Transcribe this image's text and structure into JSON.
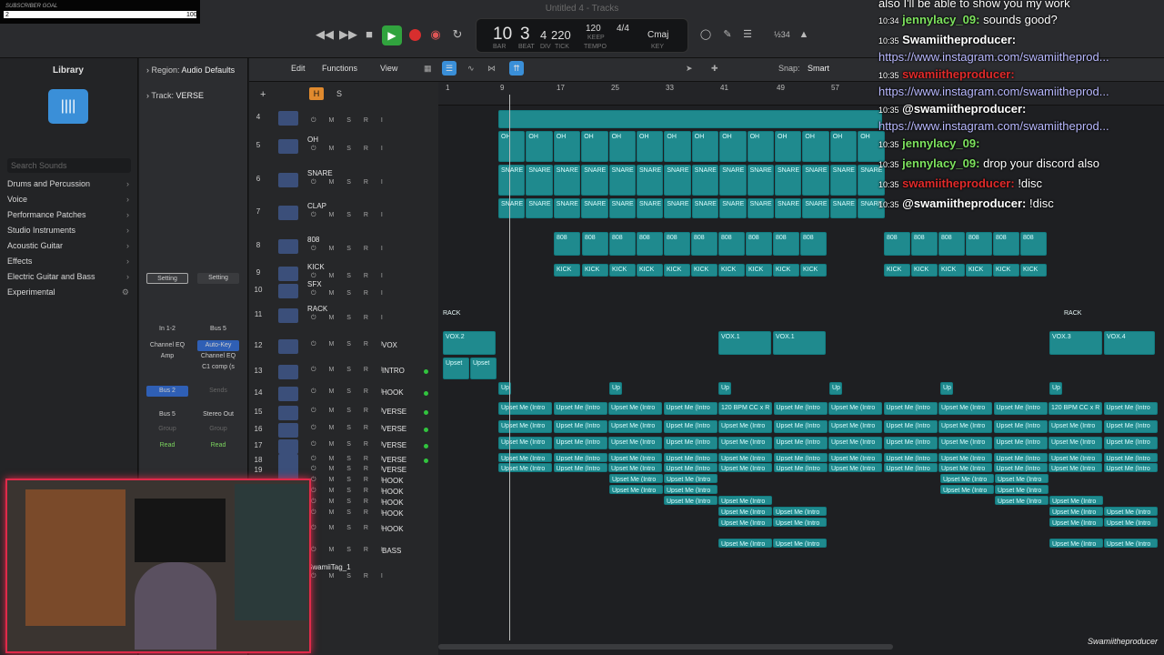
{
  "subscriber": {
    "label": "SUBSCRIBER GOAL",
    "current": "2",
    "goal": "100"
  },
  "window": {
    "title": "Untitled 4 - Tracks"
  },
  "transport": {
    "bar": "10",
    "beat": "3",
    "div": "4",
    "tick": "220",
    "bar_label": "BAR",
    "beat_label": "BEAT",
    "div_label": "DIV",
    "tick_label": "TICK",
    "tempo": "120",
    "tempo_mode": "KEEP",
    "tempo_label": "TEMPO",
    "time_sig": "4/4",
    "key": "Cmaj",
    "key_label": "KEY",
    "cpu": "½34"
  },
  "library": {
    "title": "Library",
    "search_placeholder": "Search Sounds",
    "items": [
      "Drums and Percussion",
      "Voice",
      "Performance Patches",
      "Studio Instruments",
      "Acoustic Guitar",
      "Effects",
      "Electric Guitar and Bass",
      "Experimental"
    ]
  },
  "inspector": {
    "region_label": "Region:",
    "region_value": "Audio Defaults",
    "track_label": "Track:",
    "track_value": "VERSE",
    "setting1": "Setting",
    "setting2": "Setting",
    "input1": "In 1-2",
    "input2": "Bus 5",
    "eq1": "Channel EQ",
    "amp": "Amp",
    "autokey": "Auto-Key",
    "eq2": "Channel EQ",
    "comp": "C1 comp (s",
    "bus2": "Bus 2",
    "sends": "Sends",
    "bus5": "Bus 5",
    "stereo": "Stereo Out",
    "group1": "Group",
    "group2": "Group",
    "read1": "Read",
    "read2": "Read"
  },
  "toolbar": {
    "edit": "Edit",
    "functions": "Functions",
    "view": "View",
    "snap_label": "Snap:",
    "snap_value": "Smart",
    "H": "H",
    "S": "S"
  },
  "tracks": [
    {
      "num": "4",
      "name": ""
    },
    {
      "num": "5",
      "name": "OH"
    },
    {
      "num": "6",
      "name": "SNARE"
    },
    {
      "num": "7",
      "name": "CLAP"
    },
    {
      "num": "8",
      "name": "808"
    },
    {
      "num": "9",
      "name": "KICK"
    },
    {
      "num": "10",
      "name": "SFX"
    },
    {
      "num": "11",
      "name": "RACK"
    },
    {
      "num": "12",
      "name": "VOX"
    },
    {
      "num": "13",
      "name": "INTRO"
    },
    {
      "num": "14",
      "name": "HOOK"
    },
    {
      "num": "15",
      "name": "VERSE"
    },
    {
      "num": "16",
      "name": "VERSE"
    },
    {
      "num": "17",
      "name": "VERSE"
    },
    {
      "num": "18",
      "name": "VERSE"
    },
    {
      "num": "19",
      "name": "VERSE"
    },
    {
      "num": "",
      "name": "HOOK"
    },
    {
      "num": "",
      "name": "HOOK"
    },
    {
      "num": "",
      "name": "HOOK"
    },
    {
      "num": "",
      "name": "HOOK"
    },
    {
      "num": "",
      "name": "HOOK"
    },
    {
      "num": "",
      "name": "BASS"
    },
    {
      "num": "",
      "name": "SwamiiTag_1"
    }
  ],
  "ruler": [
    "1",
    "9",
    "17",
    "25",
    "33",
    "41",
    "49",
    "57"
  ],
  "regions": {
    "oh": "OH",
    "snare": "SNARE",
    "clap": "SNARE",
    "r808": "808",
    "kick": "KICK",
    "rack": "RACK",
    "vox2": "VOX.2",
    "vox1": "VOX.1",
    "vox3": "VOX.3",
    "vox4": "VOX.4",
    "upset": "Upset",
    "up": "Up",
    "upsetme": "Upset Me (Intro",
    "bpm": "120 BPM CC x R"
  },
  "chat": [
    {
      "time": "",
      "user": "",
      "text": "also I'll be able to show you my work"
    },
    {
      "time": "10:34",
      "user": "jennylacy_09:",
      "text": "sounds good?"
    },
    {
      "time": "10:35",
      "user": "Swamiitheproducer:",
      "text": ""
    },
    {
      "time": "",
      "user": "",
      "text": "https://www.instagram.com/swamiitheprod..."
    },
    {
      "time": "10:35",
      "user": "swamiitheproducer:",
      "text": ""
    },
    {
      "time": "",
      "user": "",
      "text": "https://www.instagram.com/swamiitheprod..."
    },
    {
      "time": "10:35",
      "user": "@swamiitheproducer:",
      "text": ""
    },
    {
      "time": "",
      "user": "",
      "text": "https://www.instagram.com/swamiitheprod..."
    },
    {
      "time": "10:35",
      "user": "jennylacy_09:",
      "text": ""
    },
    {
      "time": "10:35",
      "user": "jennylacy_09:",
      "text": "drop your discord also"
    },
    {
      "time": "10:35",
      "user": "swamiitheproducer:",
      "text": "!disc"
    },
    {
      "time": "10:35",
      "user": "@swamiitheproducer:",
      "text": "!disc"
    }
  ],
  "watermark": "Swamiitheproducer"
}
